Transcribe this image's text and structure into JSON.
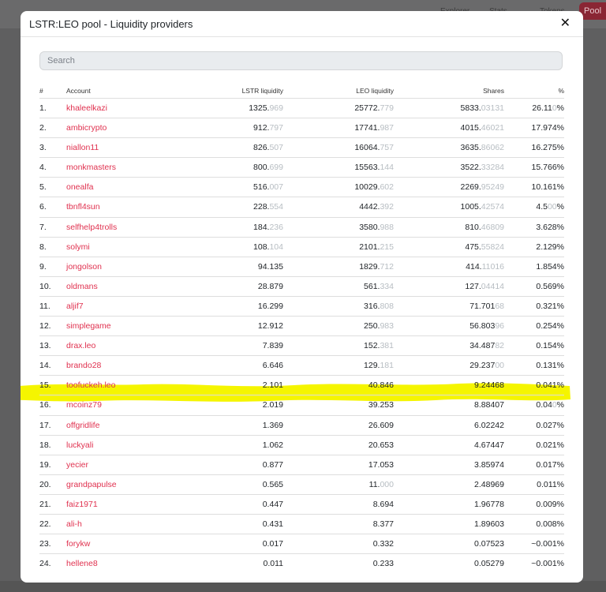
{
  "background": {
    "nav_items": [
      "Explorer",
      "Stats",
      "Tokens"
    ],
    "pool_button": "Pool"
  },
  "modal": {
    "title": "LSTR:LEO pool - Liquidity providers",
    "close_icon": "close-icon",
    "search": {
      "placeholder": "Search",
      "value": ""
    },
    "columns": [
      "#",
      "Account",
      "LSTR liquidity",
      "LEO liquidity",
      "Shares",
      "%"
    ],
    "highlight_color": "#f5f500",
    "accent_color": "#e0314f",
    "rows": [
      {
        "n": "1.",
        "account": "khaleelkazi",
        "lstr": [
          "1325.",
          "969"
        ],
        "leo": [
          "25772.",
          "779"
        ],
        "shares": [
          "5833.",
          "03131"
        ],
        "pct": [
          "26.11",
          "0",
          "%"
        ]
      },
      {
        "n": "2.",
        "account": "ambicrypto",
        "lstr": [
          "912.",
          "797"
        ],
        "leo": [
          "17741.",
          "987"
        ],
        "shares": [
          "4015.",
          "46021"
        ],
        "pct": [
          "17.974%",
          "",
          ""
        ]
      },
      {
        "n": "3.",
        "account": "niallon11",
        "lstr": [
          "826.",
          "507"
        ],
        "leo": [
          "16064.",
          "757"
        ],
        "shares": [
          "3635.",
          "86062"
        ],
        "pct": [
          "16.275%",
          "",
          ""
        ]
      },
      {
        "n": "4.",
        "account": "monkmasters",
        "lstr": [
          "800.",
          "699"
        ],
        "leo": [
          "15563.",
          "144"
        ],
        "shares": [
          "3522.",
          "33284"
        ],
        "pct": [
          "15.766%",
          "",
          ""
        ]
      },
      {
        "n": "5.",
        "account": "onealfa",
        "lstr": [
          "516.",
          "007"
        ],
        "leo": [
          "10029.",
          "602"
        ],
        "shares": [
          "2269.",
          "95249"
        ],
        "pct": [
          "10.161%",
          "",
          ""
        ]
      },
      {
        "n": "6.",
        "account": "tbnfl4sun",
        "lstr": [
          "228.",
          "554"
        ],
        "leo": [
          "4442.",
          "392"
        ],
        "shares": [
          "1005.",
          "42574"
        ],
        "pct": [
          "4.5",
          "00",
          "%"
        ]
      },
      {
        "n": "7.",
        "account": "selfhelp4trolls",
        "lstr": [
          "184.",
          "236"
        ],
        "leo": [
          "3580.",
          "988"
        ],
        "shares": [
          "810.",
          "46809"
        ],
        "pct": [
          "3.628%",
          "",
          ""
        ]
      },
      {
        "n": "8.",
        "account": "solymi",
        "lstr": [
          "108.",
          "104"
        ],
        "leo": [
          "2101.",
          "215"
        ],
        "shares": [
          "475.",
          "55824"
        ],
        "pct": [
          "2.129%",
          "",
          ""
        ]
      },
      {
        "n": "9.",
        "account": "jongolson",
        "lstr": [
          "94.135",
          ""
        ],
        "leo": [
          "1829.",
          "712"
        ],
        "shares": [
          "414.",
          "11016"
        ],
        "pct": [
          "1.854%",
          "",
          ""
        ]
      },
      {
        "n": "10.",
        "account": "oldmans",
        "lstr": [
          "28.879",
          ""
        ],
        "leo": [
          "561.",
          "334"
        ],
        "shares": [
          "127.",
          "04414"
        ],
        "pct": [
          "0.569%",
          "",
          ""
        ]
      },
      {
        "n": "11.",
        "account": "aljif7",
        "lstr": [
          "16.299",
          ""
        ],
        "leo": [
          "316.",
          "808"
        ],
        "shares": [
          "71.701",
          "68"
        ],
        "pct": [
          "0.321%",
          "",
          ""
        ]
      },
      {
        "n": "12.",
        "account": "simplegame",
        "lstr": [
          "12.912",
          ""
        ],
        "leo": [
          "250.",
          "983"
        ],
        "shares": [
          "56.803",
          "96"
        ],
        "pct": [
          "0.254%",
          "",
          ""
        ]
      },
      {
        "n": "13.",
        "account": "drax.leo",
        "lstr": [
          "7.839",
          ""
        ],
        "leo": [
          "152.",
          "381"
        ],
        "shares": [
          "34.487",
          "82"
        ],
        "pct": [
          "0.154%",
          "",
          ""
        ]
      },
      {
        "n": "14.",
        "account": "brando28",
        "lstr": [
          "6.646",
          ""
        ],
        "leo": [
          "129.",
          "181"
        ],
        "shares": [
          "29.237",
          "00"
        ],
        "pct": [
          "0.131%",
          "",
          ""
        ]
      },
      {
        "n": "15.",
        "account": "toofuckeh.leo",
        "lstr": [
          "2.101",
          ""
        ],
        "leo": [
          "40.846",
          ""
        ],
        "shares": [
          "9.24468",
          ""
        ],
        "pct": [
          "0.041%",
          "",
          ""
        ],
        "highlighted": true
      },
      {
        "n": "16.",
        "account": "mcoinz79",
        "lstr": [
          "2.019",
          ""
        ],
        "leo": [
          "39.253",
          ""
        ],
        "shares": [
          "8.88407",
          ""
        ],
        "pct": [
          "0.04",
          "0",
          "%"
        ]
      },
      {
        "n": "17.",
        "account": "offgridlife",
        "lstr": [
          "1.369",
          ""
        ],
        "leo": [
          "26.609",
          ""
        ],
        "shares": [
          "6.02242",
          ""
        ],
        "pct": [
          "0.027%",
          "",
          ""
        ]
      },
      {
        "n": "18.",
        "account": "luckyali",
        "lstr": [
          "1.062",
          ""
        ],
        "leo": [
          "20.653",
          ""
        ],
        "shares": [
          "4.67447",
          ""
        ],
        "pct": [
          "0.021%",
          "",
          ""
        ]
      },
      {
        "n": "19.",
        "account": "yecier",
        "lstr": [
          "0.877",
          ""
        ],
        "leo": [
          "17.053",
          ""
        ],
        "shares": [
          "3.85974",
          ""
        ],
        "pct": [
          "0.017%",
          "",
          ""
        ]
      },
      {
        "n": "20.",
        "account": "grandpapulse",
        "lstr": [
          "0.565",
          ""
        ],
        "leo": [
          "11.",
          "000"
        ],
        "shares": [
          "2.48969",
          ""
        ],
        "pct": [
          "0.011%",
          "",
          ""
        ]
      },
      {
        "n": "21.",
        "account": "faiz1971",
        "lstr": [
          "0.447",
          ""
        ],
        "leo": [
          "8.694",
          ""
        ],
        "shares": [
          "1.96778",
          ""
        ],
        "pct": [
          "0.009%",
          "",
          ""
        ]
      },
      {
        "n": "22.",
        "account": "ali-h",
        "lstr": [
          "0.431",
          ""
        ],
        "leo": [
          "8.377",
          ""
        ],
        "shares": [
          "1.89603",
          ""
        ],
        "pct": [
          "0.008%",
          "",
          ""
        ]
      },
      {
        "n": "23.",
        "account": "forykw",
        "lstr": [
          "0.017",
          ""
        ],
        "leo": [
          "0.332",
          ""
        ],
        "shares": [
          "0.07523",
          ""
        ],
        "pct": [
          "~0.001%",
          "",
          ""
        ]
      },
      {
        "n": "24.",
        "account": "hellene8",
        "lstr": [
          "0.011",
          ""
        ],
        "leo": [
          "0.233",
          ""
        ],
        "shares": [
          "0.05279",
          ""
        ],
        "pct": [
          "~0.001%",
          "",
          ""
        ]
      }
    ]
  }
}
